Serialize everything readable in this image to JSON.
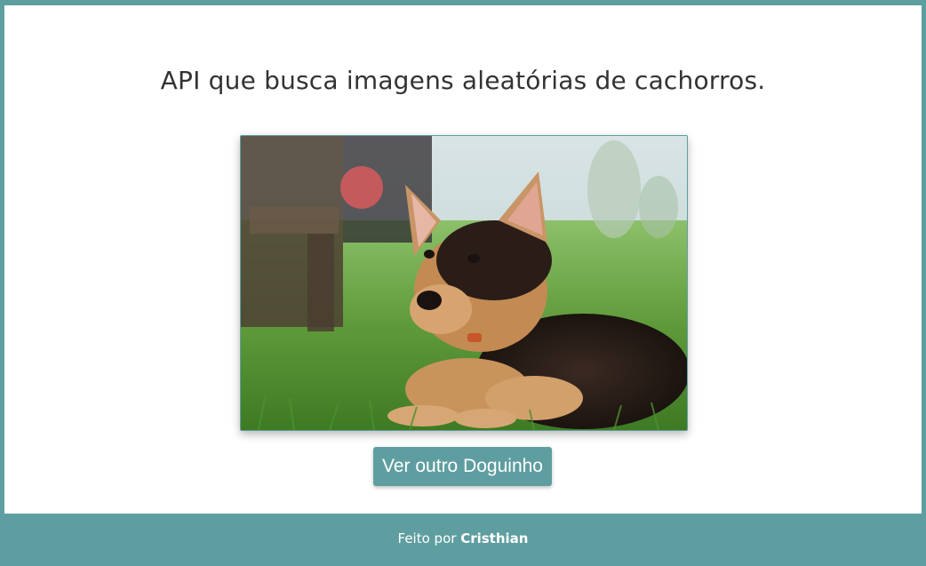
{
  "header": {
    "title": "API que busca imagens aleatórias de cachorros."
  },
  "image": {
    "alt": "German Shepherd puppy lying on grass"
  },
  "actions": {
    "next_button_label": "Ver outro Doguinho"
  },
  "footer": {
    "prefix": "Feito por",
    "author": "Cristhian"
  },
  "colors": {
    "accent": "#5f9ea0",
    "background": "#ffffff",
    "title_text": "#333333"
  }
}
